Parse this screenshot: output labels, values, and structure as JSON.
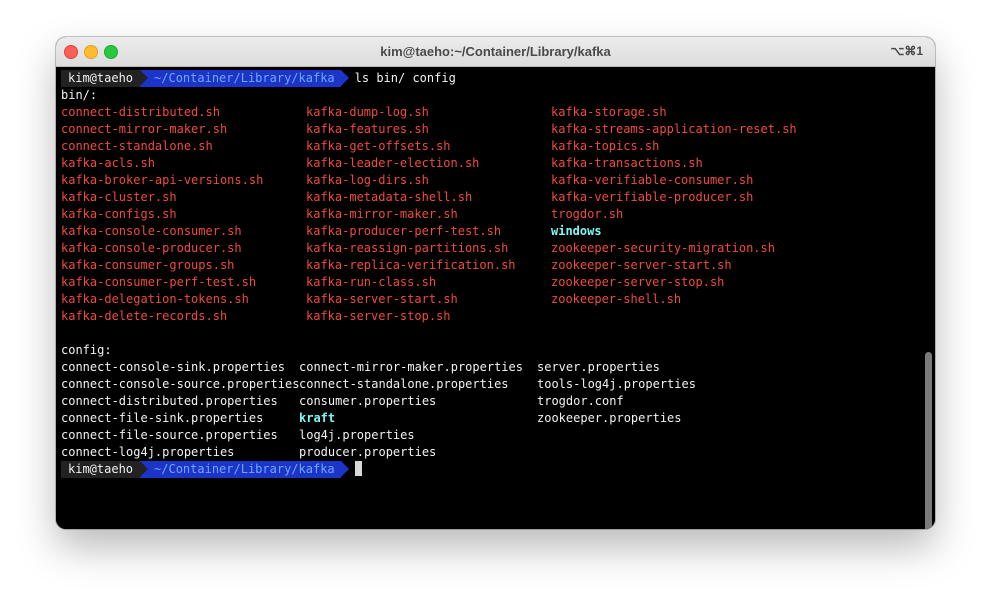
{
  "window": {
    "title": "kim@taeho:~/Container/Library/kafka",
    "shortcut": "⌥⌘1"
  },
  "prompt": {
    "user": "kim@taeho",
    "path": "~/Container/Library/kafka",
    "command": "ls bin/ config"
  },
  "bin": {
    "heading": "bin/:",
    "columns": [
      [
        "connect-distributed.sh",
        "connect-mirror-maker.sh",
        "connect-standalone.sh",
        "kafka-acls.sh",
        "kafka-broker-api-versions.sh",
        "kafka-cluster.sh",
        "kafka-configs.sh",
        "kafka-console-consumer.sh",
        "kafka-console-producer.sh",
        "kafka-consumer-groups.sh",
        "kafka-consumer-perf-test.sh",
        "kafka-delegation-tokens.sh",
        "kafka-delete-records.sh"
      ],
      [
        "kafka-dump-log.sh",
        "kafka-features.sh",
        "kafka-get-offsets.sh",
        "kafka-leader-election.sh",
        "kafka-log-dirs.sh",
        "kafka-metadata-shell.sh",
        "kafka-mirror-maker.sh",
        "kafka-producer-perf-test.sh",
        "kafka-reassign-partitions.sh",
        "kafka-replica-verification.sh",
        "kafka-run-class.sh",
        "kafka-server-start.sh",
        "kafka-server-stop.sh"
      ],
      [
        "kafka-storage.sh",
        "kafka-streams-application-reset.sh",
        "kafka-topics.sh",
        "kafka-transactions.sh",
        "kafka-verifiable-consumer.sh",
        "kafka-verifiable-producer.sh",
        "trogdor.sh",
        "windows",
        "zookeeper-security-migration.sh",
        "zookeeper-server-start.sh",
        "zookeeper-server-stop.sh",
        "zookeeper-shell.sh"
      ]
    ],
    "directories": [
      "windows"
    ]
  },
  "config": {
    "heading": "config:",
    "columns": [
      [
        "connect-console-sink.properties",
        "connect-console-source.properties",
        "connect-distributed.properties",
        "connect-file-sink.properties",
        "connect-file-source.properties",
        "connect-log4j.properties"
      ],
      [
        "connect-mirror-maker.properties",
        "connect-standalone.properties",
        "consumer.properties",
        "kraft",
        "log4j.properties",
        "producer.properties"
      ],
      [
        "server.properties",
        "tools-log4j.properties",
        "trogdor.conf",
        "zookeeper.properties"
      ]
    ],
    "directories": [
      "kraft"
    ]
  },
  "colors": {
    "executable": "#ef4b3f",
    "directory": "#7ff7f8",
    "path_segment": "#1c35c8",
    "background": "#000000"
  }
}
